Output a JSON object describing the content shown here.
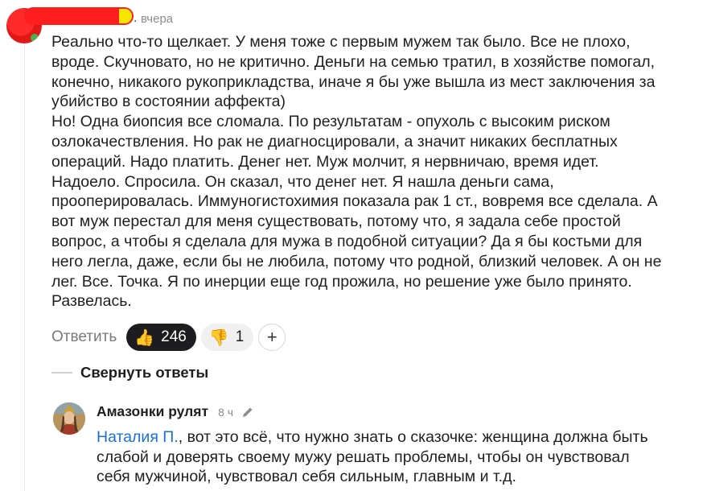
{
  "top_comment": {
    "date": "вчера",
    "paragraphs": [
      "Реально что-то щелкает. У меня тоже с первым мужем так было. Все не плохо,\nвроде. Скучновато, но не критично. Деньги на семью тратил, в хозяйстве помогал,\nконечно, никакого рукоприкладства, иначе я бы уже вышла из мест заключения за\nубийство в состоянии аффекта)",
      "Но! Одна биопсия все сломала. По результатам - опухоль с высоким риском\nозлокачествления. Но рак не диагносцировали, а значит никаких бесплатных\nопераций. Надо платить. Денег нет. Муж молчит, я нервничаю, время идет.\nНадоело. Спросила. Он сказал, что денег нет. Я нашла деньги сама,\nпрооперировалась. Иммуногистохимия показала рак 1 ст., вовремя все сделала. А\nвот муж перестал для меня существовать, потому что, я задала себе простой\nвопрос, а чтобы я сделала для мужа в подобной ситуации? Да я бы костьми для\nнего легла, даже, если бы не любила, потому что родной, близкий человек. А он не\nлег. Все. Точка. Я по инерции еще год прожила, но решение уже было принято.\nРазвелась."
    ],
    "actions": {
      "reply_label": "Ответить",
      "like_icon": "thumbs-up-emoji",
      "like_count": "246",
      "dislike_icon": "thumbs-down-emoji",
      "dislike_count": "1",
      "add_reaction_label": "+"
    }
  },
  "collapse_replies_label": "Свернуть ответы",
  "reply": {
    "author": "Амазонки рулят",
    "time": "8 ч",
    "mention": "Наталия П.",
    "text": ", вот это всё, что нужно знать о сказочке: женщина должна быть\nслабой и доверять своему мужу решать проблемы, чтобы он чувствовал\nсебя мужчиной, чувствовал себя сильным, главным и т.д."
  },
  "colors": {
    "accent_link": "#1a6fd6",
    "like_pill": "#1d1d1f",
    "muted_text": "#8c8c8c"
  }
}
